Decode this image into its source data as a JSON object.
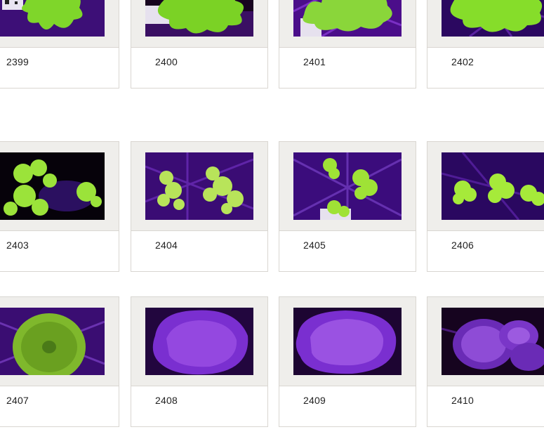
{
  "gallery": {
    "items": [
      {
        "label": "2399",
        "subject": "green-leather-coral"
      },
      {
        "label": "2400",
        "subject": "green-leather-coral"
      },
      {
        "label": "2401",
        "subject": "green-leather-coral"
      },
      {
        "label": "2402",
        "subject": "green-leather-coral"
      },
      {
        "label": "2403",
        "subject": "green-acropora-frags"
      },
      {
        "label": "2404",
        "subject": "green-acropora-frags"
      },
      {
        "label": "2405",
        "subject": "green-acropora-frags"
      },
      {
        "label": "2406",
        "subject": "green-acropora-frags"
      },
      {
        "label": "2407",
        "subject": "green-mushroom-coral"
      },
      {
        "label": "2408",
        "subject": "purple-mushroom-coral"
      },
      {
        "label": "2409",
        "subject": "purple-mushroom-coral"
      },
      {
        "label": "2410",
        "subject": "purple-mushroom-cluster"
      }
    ]
  },
  "colors": {
    "frame": "#efeeeb",
    "border": "#d9d6d1",
    "caption": "#222222",
    "uv_purple": "#5a12a0",
    "coral_green": "#8ee62a"
  }
}
